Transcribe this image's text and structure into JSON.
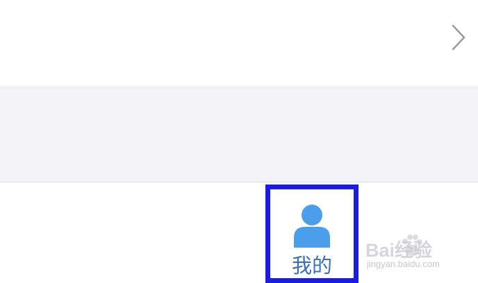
{
  "tab_bar": {
    "mine_tab": {
      "label": "我的",
      "icon": "user-icon",
      "accent_color": "#4a9eea",
      "label_color": "#3b6fb6",
      "highlight_color": "#1b1be6"
    }
  },
  "list_row": {
    "chevron_icon": "chevron-right-icon"
  },
  "watermark": {
    "logo_text": "Bai经验",
    "url": "jingyan.baidu.com"
  }
}
